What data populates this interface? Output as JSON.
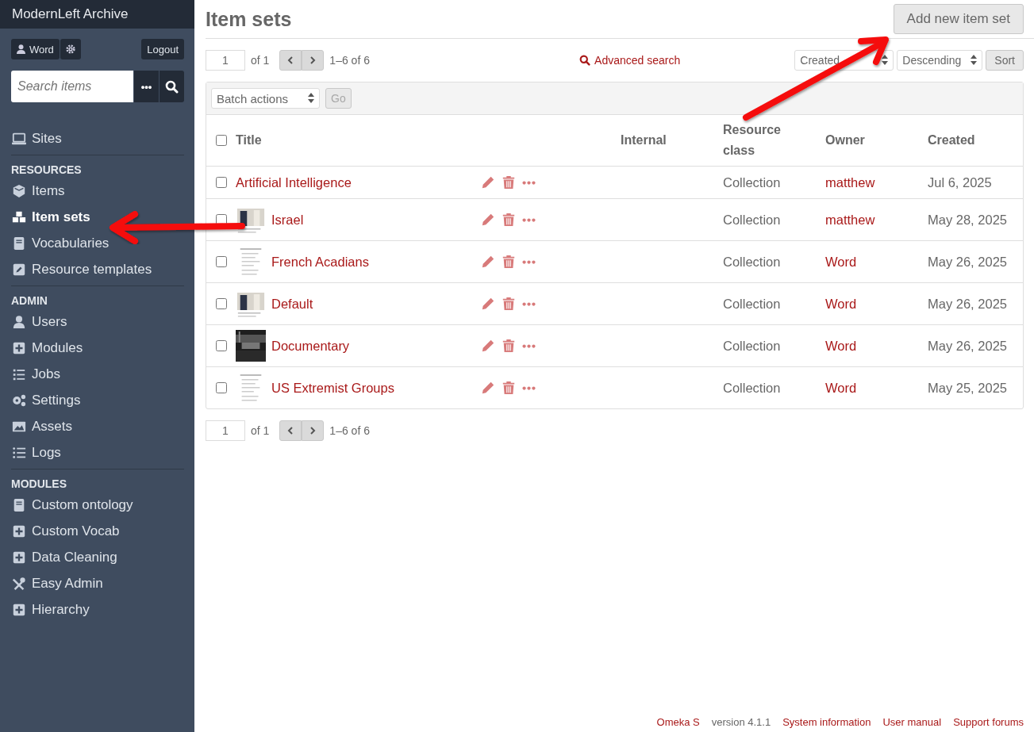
{
  "sidebar": {
    "site_title": "ModernLeft Archive",
    "user_button": "Word",
    "logout_button": "Logout",
    "search": {
      "placeholder": "Search items"
    },
    "options_button": "•••",
    "sections": [
      {
        "items": [
          {
            "label": "Sites",
            "selected": false
          }
        ]
      },
      {
        "heading": "RESOURCES",
        "items": [
          {
            "label": "Items",
            "selected": false
          },
          {
            "label": "Item sets",
            "selected": true
          },
          {
            "label": "Vocabularies",
            "selected": false
          },
          {
            "label": "Resource templates",
            "selected": false
          }
        ]
      },
      {
        "heading": "ADMIN",
        "items": [
          {
            "label": "Users",
            "selected": false
          },
          {
            "label": "Modules",
            "selected": false
          },
          {
            "label": "Jobs",
            "selected": false
          },
          {
            "label": "Settings",
            "selected": false
          },
          {
            "label": "Assets",
            "selected": false
          },
          {
            "label": "Logs",
            "selected": false
          }
        ]
      },
      {
        "heading": "MODULES",
        "items": [
          {
            "label": "Custom ontology",
            "selected": false
          },
          {
            "label": "Custom Vocab",
            "selected": false
          },
          {
            "label": "Data Cleaning",
            "selected": false
          },
          {
            "label": "Easy Admin",
            "selected": false
          },
          {
            "label": "Hierarchy",
            "selected": false
          }
        ]
      }
    ]
  },
  "page_title": "Item sets",
  "add_button": "Add new item set",
  "pagination_top": {
    "page": "1",
    "of": "of 1",
    "range": "1–6 of 6"
  },
  "advanced_search": "Advanced search",
  "sort": {
    "field": "Created",
    "order": "Descending",
    "button": "Sort"
  },
  "batch": {
    "select": "Batch actions",
    "go_button": "Go"
  },
  "table": {
    "select_all_checked": false,
    "columns": [
      "Title",
      "Internal",
      "Resource class",
      "Owner",
      "Created"
    ],
    "rows": [
      {
        "title": "Artificial Intelligence",
        "thumbnail": null,
        "resource_class": "Collection",
        "owner": "matthew",
        "created": "Jul 6, 2025",
        "checked": false
      },
      {
        "title": "Israel",
        "resource_class": "Collection",
        "owner": "matthew",
        "created": "May 28, 2025",
        "checked": false
      },
      {
        "title": "French Acadians",
        "resource_class": "Collection",
        "owner": "Word",
        "created": "May 26, 2025",
        "checked": false
      },
      {
        "title": "Default",
        "resource_class": "Collection",
        "owner": "Word",
        "created": "May 26, 2025",
        "checked": false
      },
      {
        "title": "Documentary",
        "resource_class": "Collection",
        "owner": "Word",
        "created": "May 26, 2025",
        "checked": false
      },
      {
        "title": "US Extremist Groups",
        "resource_class": "Collection",
        "owner": "Word",
        "created": "May 25, 2025",
        "checked": false
      }
    ]
  },
  "pagination_bottom": {
    "page": "1",
    "of": "of 1",
    "range": "1–6 of 6"
  },
  "footer": {
    "product": "Omeka S",
    "version": "version 4.1.1",
    "links": [
      "System information",
      "User manual",
      "Support forums"
    ]
  },
  "annotations": [
    {
      "kind": "arrow"
    },
    {
      "kind": "arrow"
    }
  ]
}
